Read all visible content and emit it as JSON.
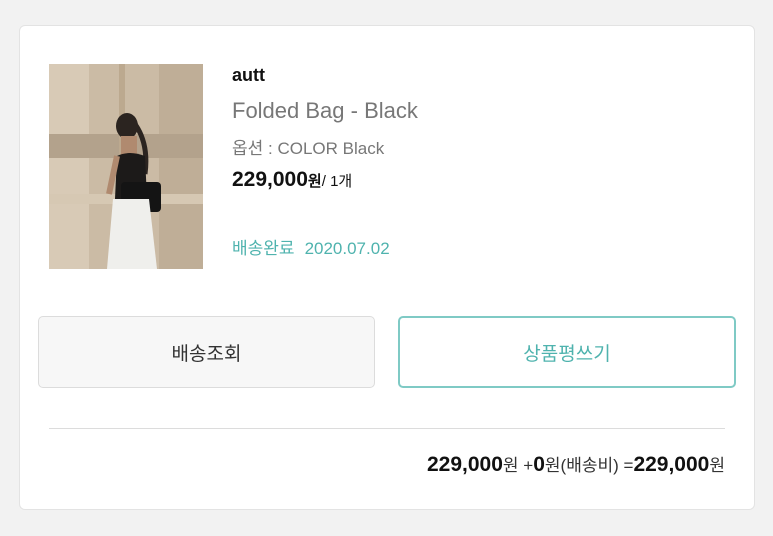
{
  "order_item": {
    "brand": "autt",
    "product_name": "Folded Bag - Black",
    "option": "옵션 : COLOR Black",
    "price": "229,000",
    "price_unit": "원",
    "quantity": "/ 1개",
    "shipping_status": "배송완료",
    "shipping_date": "2020.07.02"
  },
  "buttons": {
    "track": "배송조회",
    "review": "상품평쓰기"
  },
  "summary": {
    "item_total": "229,000",
    "won1": "원",
    "plus": " +",
    "shipping_fee": "0",
    "shipping_label": "원(배송비) =",
    "grand_total": "229,000",
    "won2": "원"
  },
  "colors": {
    "accent": "#4fb3ae",
    "accent_border": "#7fcac5",
    "text_muted": "#777777"
  }
}
